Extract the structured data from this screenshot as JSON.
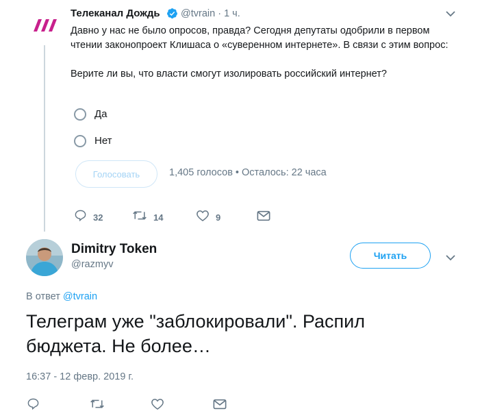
{
  "colors": {
    "accent": "#1da1f2",
    "muted": "#657786",
    "logo": "#c8208c"
  },
  "tweet": {
    "author_name": "Телеканал Дождь",
    "handle": "@tvrain",
    "separator": "·",
    "time": "1 ч.",
    "text": "Давно у нас не было опросов, правда? Сегодня депутаты одобрили в первом чтении законопроект Клишаса о «суверенном интернете». В связи с этим вопрос:\n\nВерите ли вы, что власти смогут изолировать российский интернет?",
    "poll": {
      "options": [
        "Да",
        "Нет"
      ],
      "vote_label": "Голосовать",
      "meta": "1,405 голосов • Осталось: 22 часа"
    },
    "actions": {
      "replies": "32",
      "retweets": "14",
      "likes": "9"
    }
  },
  "reply": {
    "author_name": "Dimitry Token",
    "handle": "@razmyv",
    "follow_label": "Читать",
    "reply_to_prefix": "В ответ ",
    "reply_to_handle": "@tvrain",
    "text": "Телеграм уже \"заблокировали\". Распил бюджета. Не более…",
    "timestamp": "16:37 - 12 февр. 2019 г."
  },
  "icons": [
    "tvrain-logo-icon",
    "verified-badge-icon",
    "chevron-down-icon",
    "reply-icon",
    "retweet-icon",
    "like-icon",
    "message-icon"
  ]
}
